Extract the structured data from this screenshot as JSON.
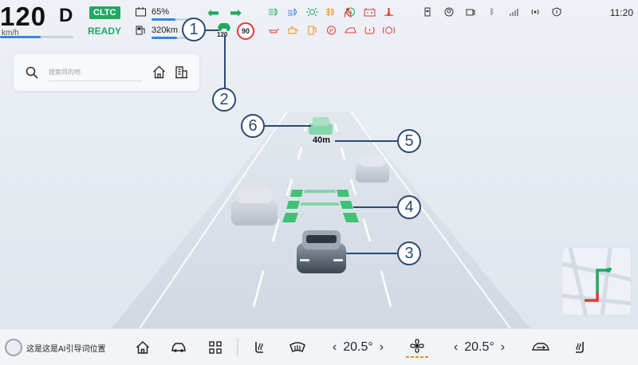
{
  "cluster": {
    "speed": "120",
    "gear": "D",
    "speed_unit": "km/h",
    "range_mode": "CLTC",
    "ready": "READY",
    "battery_pct": "65%",
    "battery_level": 0.65,
    "range": "320km",
    "range_level": 0.7,
    "acc_set_speed": "120",
    "speed_limit": "90",
    "clock": "11:20"
  },
  "colors": {
    "green": "#21a862",
    "blue": "#3c82e6",
    "red": "#e53935",
    "orange": "#f08c1e",
    "callout": "#2a4a72"
  },
  "indicators_green": [
    "high-beam-icon",
    "low-beam-icon",
    "position-lamp-icon",
    "fog-lamp-icon",
    "auto-hold-icon"
  ],
  "indicators_red": [
    "battery-fault-icon",
    "coolant-temp-icon",
    "oil-pressure-icon",
    "engine-check-icon",
    "fuel-warning-icon",
    "parking-brake-icon",
    "door-open-icon",
    "tire-pressure-icon",
    "abs-icon",
    "seatbelt-icon"
  ],
  "system_icons": [
    "usb-icon",
    "user-icon",
    "dashcam-icon",
    "bluetooth-icon",
    "signal-icon",
    "wifi-icon",
    "shield-icon"
  ],
  "search": {
    "placeholder": "搜索目的地"
  },
  "scene": {
    "lead_distance": "40m"
  },
  "callouts": [
    "1",
    "2",
    "3",
    "4",
    "5",
    "6"
  ],
  "dock": {
    "ai_prompt": "这是这是AI引导词位置",
    "temp_left": "20.5°",
    "temp_right": "20.5°"
  }
}
